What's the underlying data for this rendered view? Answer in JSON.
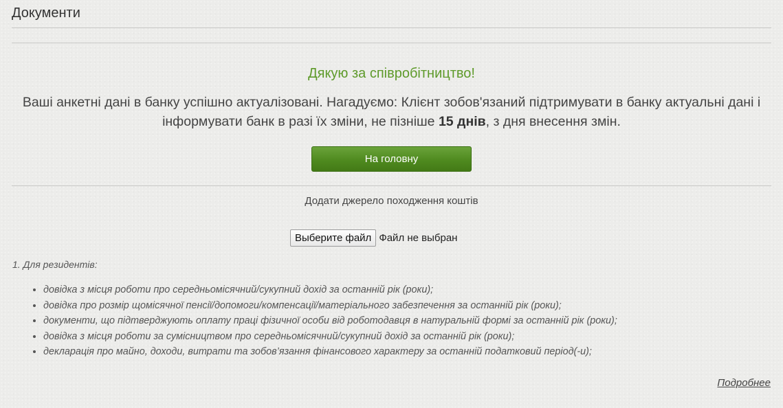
{
  "header": {
    "title": "Документи"
  },
  "confirmation": {
    "thanks": "Дякую за співробітництво!",
    "message_part1": "Ваші анкетні дані в банку успішно актуалізовані. Нагадуємо: Клієнт зобов'язаний підтримувати в банку актуальні дані і інформувати банк в разі їх зміни, не пізніше ",
    "message_bold": "15 днів",
    "message_part2": ", з дня внесення змін.",
    "home_button": "На головну"
  },
  "funds_source": {
    "label": "Додати джерело походження коштів",
    "file_button": "Выберите файл",
    "file_status": "Файл не выбран"
  },
  "residents": {
    "title": "1. Для резидентів:",
    "items": [
      "довідка з місця роботи про середньомісячний/сукупний дохід за останній рік (роки);",
      "довідка про розмір щомісячної пенсії/допомоги/компенсації/матеріального забезпечення за останній рік (роки);",
      "документи, що підтверджують оплату праці фізичної особи від роботодавця в натуральній формі за останній рік (роки);",
      "довідка з місця роботи за сумісництвом про середньомісячний/сукупний дохід за останній рік (роки);",
      "декларація про майно, доходи, витрати та зобов’язання фінансового характеру за останній податковий період(-и);"
    ]
  },
  "more_link": "Подробнее",
  "colors": {
    "accent_green": "#5e9a2a",
    "button_green": "#4f8a1f",
    "background": "#ececea"
  }
}
